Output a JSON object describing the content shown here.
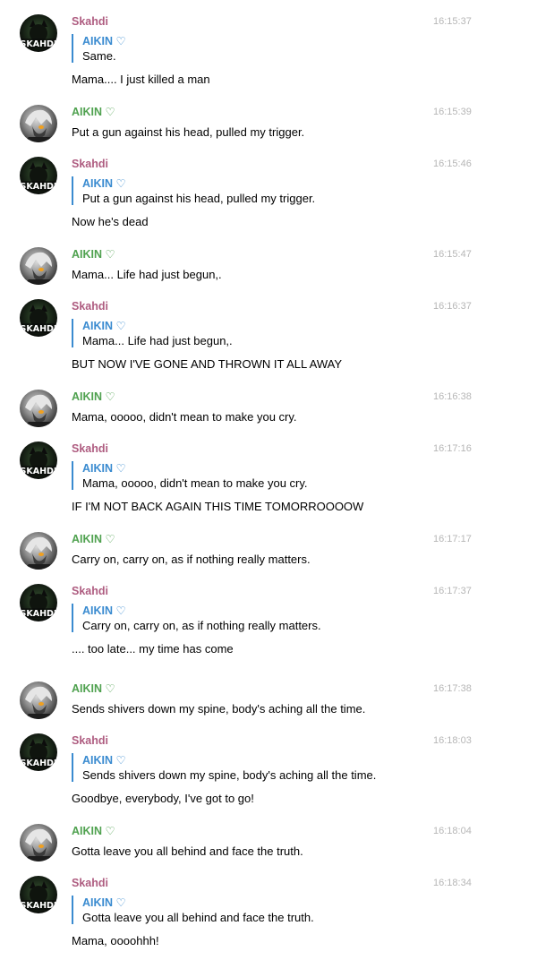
{
  "messages": [
    {
      "author": "Skahdi",
      "time": "16:15:37",
      "reply": {
        "author": "AIKIN ♡",
        "text": "Same."
      },
      "text": "Mama.... I just killed a man"
    },
    {
      "author": "AIKIN ♡",
      "time": "16:15:39",
      "text": "Put a gun against his head, pulled my trigger."
    },
    {
      "author": "Skahdi",
      "time": "16:15:46",
      "reply": {
        "author": "AIKIN ♡",
        "text": "Put a gun against his head, pulled my trigger."
      },
      "text": "Now he's dead"
    },
    {
      "author": "AIKIN ♡",
      "time": "16:15:47",
      "text": "Mama... Life had just begun,."
    },
    {
      "author": "Skahdi",
      "time": "16:16:37",
      "reply": {
        "author": "AIKIN ♡",
        "text": "Mama... Life had just begun,."
      },
      "text": "BUT NOW I'VE GONE AND THROWN IT ALL AWAY"
    },
    {
      "author": "AIKIN ♡",
      "time": "16:16:38",
      "text": "Mama, ooooo, didn't mean to make you cry."
    },
    {
      "author": "Skahdi",
      "time": "16:17:16",
      "reply": {
        "author": "AIKIN ♡",
        "text": "Mama, ooooo, didn't mean to make you cry."
      },
      "text": "IF I'M NOT BACK AGAIN THIS TIME TOMORROOOOW"
    },
    {
      "author": "AIKIN ♡",
      "time": "16:17:17",
      "text": "Carry on, carry on, as if nothing really matters."
    },
    {
      "author": "Skahdi",
      "time": "16:17:37",
      "reply": {
        "author": "AIKIN ♡",
        "text": "Carry on, carry on, as if nothing really matters."
      },
      "text": ".... too late... my time has come"
    },
    {
      "author": "AIKIN ♡",
      "time": "16:17:38",
      "text": "Sends shivers down my spine, body's aching all the time."
    },
    {
      "author": "Skahdi",
      "time": "16:18:03",
      "reply": {
        "author": "AIKIN ♡",
        "text": "Sends shivers down my spine, body's aching all the time."
      },
      "text": "Goodbye, everybody, I've got to go!"
    },
    {
      "author": "AIKIN ♡",
      "time": "16:18:04",
      "text": "Gotta leave you all behind and face the truth."
    },
    {
      "author": "Skahdi",
      "time": "16:18:34",
      "reply": {
        "author": "AIKIN ♡",
        "text": "Gotta leave you all behind and face the truth."
      },
      "text": "Mama, oooohhh!"
    }
  ],
  "avatars": {
    "skahdi": {
      "text": "SKAHDI",
      "bg": "#1a1a1a",
      "accent": "#2f4a2b"
    },
    "aikin": {
      "bg": "#8a8a8a",
      "accent": "#f0a020"
    }
  },
  "colors": {
    "skahdi_name": "#ae5c80",
    "aikin_name": "#4fa14f",
    "reply_accent": "#3a8bd0",
    "timestamp": "#b6b6b6"
  }
}
